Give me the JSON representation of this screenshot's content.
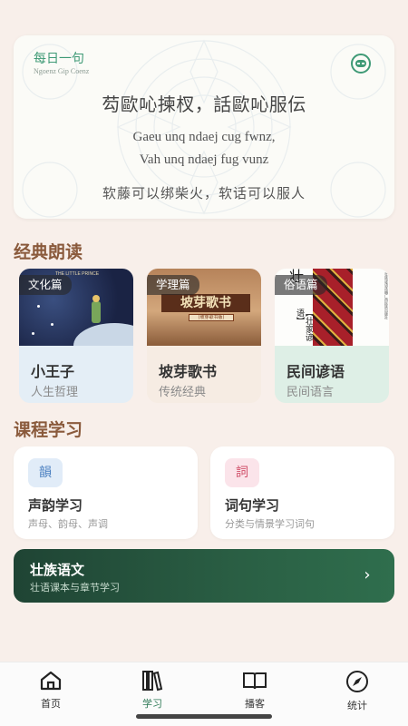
{
  "daily_quote": {
    "title": "每日一句",
    "subtitle": "Ngoenz Gip Coenz",
    "zhuang_text": "芶歐吣揀杈，話歐吣服伝",
    "roman_line1": "Gaeu unq ndaej cug fwnz,",
    "roman_line2": "Vah unq ndaej fug vunz",
    "chinese_translation": "软藤可以绑柴火，软话可以服人",
    "toggle_icon": "toggle-icon"
  },
  "classic_reading": {
    "heading": "经典朗读",
    "items": [
      {
        "category": "文化篇",
        "title": "小王子",
        "desc": "人生哲理",
        "cover_text": "THE LITTLE PRINCE"
      },
      {
        "category": "学理篇",
        "title": "坡芽歌书",
        "desc": "传统经典",
        "cover_text": "坡芽歌书",
        "cover_sub": "(坡芽歌书版)"
      },
      {
        "category": "俗语篇",
        "title": "民间谚语",
        "desc": "民间语言",
        "cover_text": "壮",
        "cover_sub": "【壮家谚语】",
        "cover_side": "壮族谚语选编广西民族出版社"
      }
    ]
  },
  "course_learning": {
    "heading": "课程学习",
    "items": [
      {
        "icon_text": "韻",
        "title": "声韵学习",
        "desc": "声母、韵母、声调"
      },
      {
        "icon_text": "詞",
        "title": "词句学习",
        "desc": "分类与情景学习词句"
      }
    ]
  },
  "banner": {
    "title": "壮族语文",
    "desc": "壮语课本与章节学习",
    "arrow": "›"
  },
  "bottom_nav": {
    "items": [
      {
        "label": "首页",
        "icon": "home-icon"
      },
      {
        "label": "学习",
        "icon": "books-icon"
      },
      {
        "label": "播客",
        "icon": "open-book-icon"
      },
      {
        "label": "统计",
        "icon": "compass-icon"
      }
    ],
    "active_index": 1,
    "active_color": "#2f7a57"
  },
  "colors": {
    "background": "#f8efea",
    "accent_green": "#3f9a76",
    "heading_brown": "#8a5a3c",
    "banner_dark": "#1f4434"
  }
}
